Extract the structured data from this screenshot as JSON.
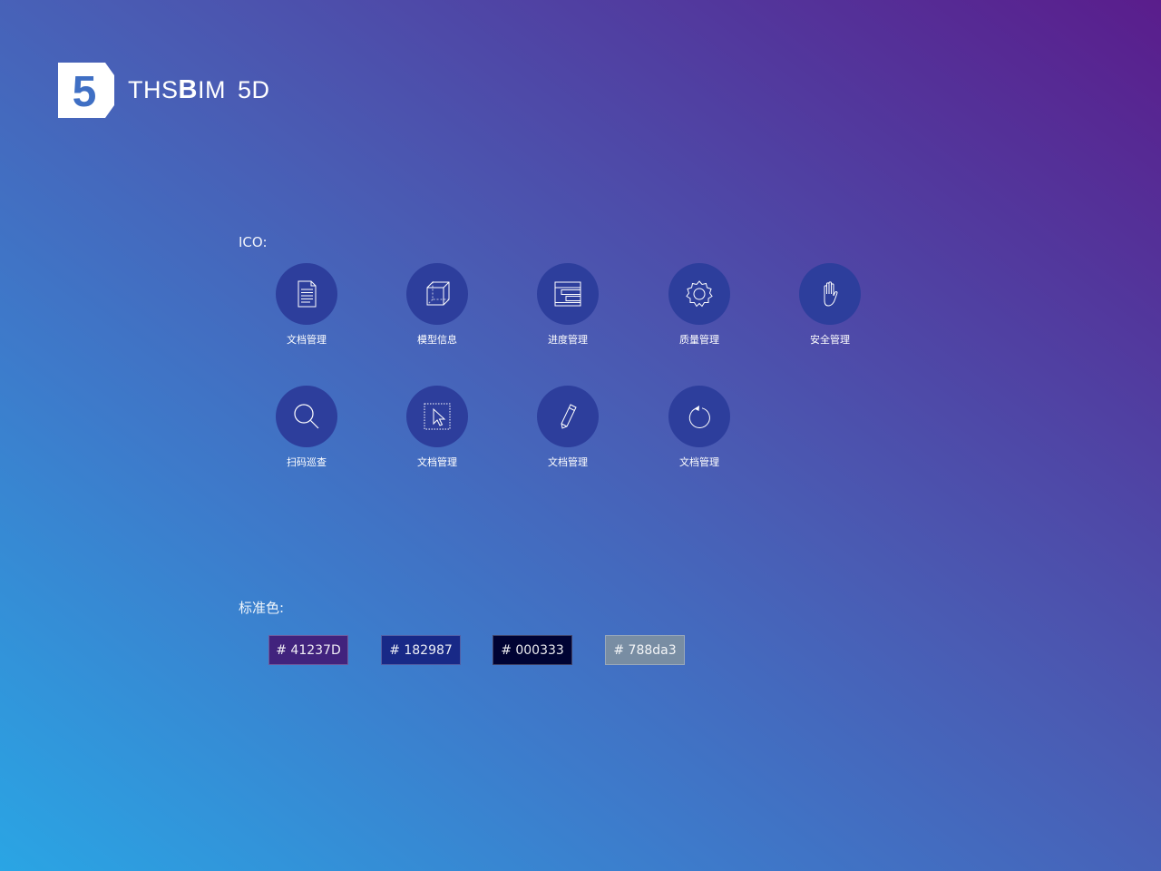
{
  "logo": {
    "mark_digit": "5",
    "name_prefix": "THS",
    "name_bold": "B",
    "name_suffix": "IM",
    "name_tail": "5D"
  },
  "icons_section": {
    "label": "ICO:",
    "items": [
      {
        "label": "文档管理",
        "icon": "document-icon"
      },
      {
        "label": "模型信息",
        "icon": "cube-icon"
      },
      {
        "label": "进度管理",
        "icon": "gantt-icon"
      },
      {
        "label": "质量管理",
        "icon": "gear-icon"
      },
      {
        "label": "安全管理",
        "icon": "hand-icon"
      },
      {
        "label": "扫码巡查",
        "icon": "search-icon"
      },
      {
        "label": "文档管理",
        "icon": "select-cursor-icon"
      },
      {
        "label": "文档管理",
        "icon": "pencil-icon"
      },
      {
        "label": "文档管理",
        "icon": "refresh-icon"
      }
    ]
  },
  "colors_section": {
    "label": "标准色:",
    "swatches": [
      {
        "label": "# 41237D",
        "color": "#41237D"
      },
      {
        "label": "# 182987",
        "color": "#182987"
      },
      {
        "label": "# 000333",
        "color": "#000333"
      },
      {
        "label": "# 788da3",
        "color": "#788da3"
      }
    ]
  },
  "icon_circle_color": "#2d3e9c"
}
